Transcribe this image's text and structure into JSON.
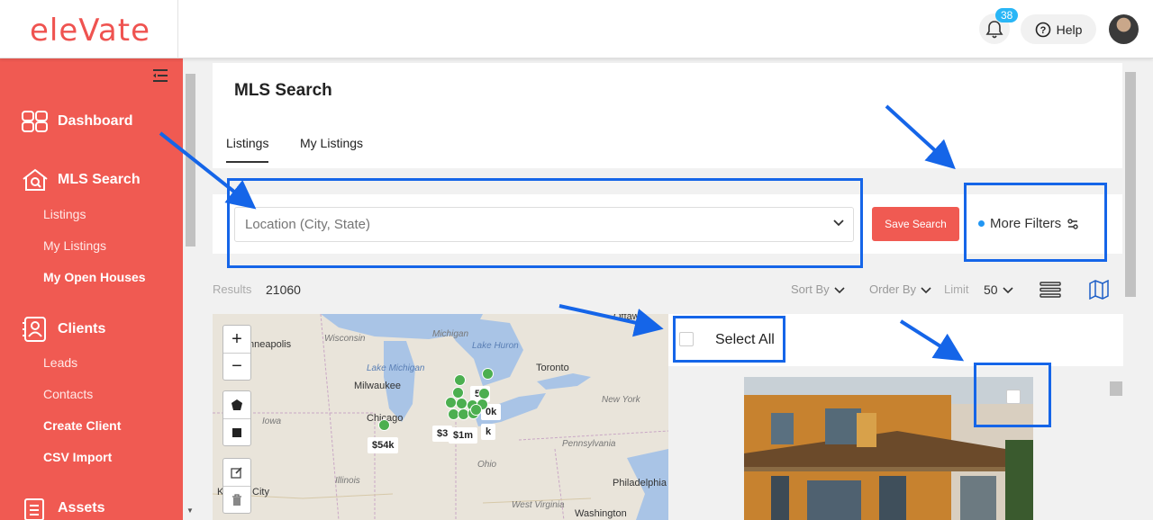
{
  "brand": {
    "logo_text": "eleVate",
    "accent": "#f05a52"
  },
  "header": {
    "notifications_count": "38",
    "help_label": "Help"
  },
  "sidebar": {
    "dashboard": "Dashboard",
    "mls_search": "MLS Search",
    "mls_items": [
      "Listings",
      "My Listings",
      "My Open Houses"
    ],
    "clients": "Clients",
    "client_items": [
      "Leads",
      "Contacts",
      "Create Client",
      "CSV Import"
    ],
    "assets": "Assets"
  },
  "page": {
    "title": "MLS Search",
    "tabs": [
      "Listings",
      "My Listings"
    ],
    "active_tab": "Listings"
  },
  "search": {
    "location_placeholder": "Location (City, State)",
    "save_label": "Save Search",
    "more_filters_label": "More Filters"
  },
  "results": {
    "label": "Results",
    "count": "21060",
    "sort_by": "Sort By",
    "order_by": "Order By",
    "limit_label": "Limit",
    "limit_value": "50"
  },
  "map": {
    "labels": {
      "minneapolis": "nneapolis",
      "wisconsin": "Wisconsin",
      "michigan": "Michigan",
      "lake_huron": "Lake Huron",
      "ottawa": "Ottawa",
      "toronto": "Toronto",
      "lake_michigan": "Lake Michigan",
      "milwaukee": "Milwaukee",
      "new_york": "New York",
      "iowa": "Iowa",
      "chicago": "Chicago",
      "pennsylvania": "Pennsylvania",
      "ohio": "Ohio",
      "illinois": "Illinois",
      "city": "City",
      "philadelphia": "Philadelphia",
      "west_virginia": "West Virginia",
      "washington": "Washington",
      "k": "K"
    },
    "price_tags": [
      "$54k",
      "$1m",
      "$3",
      "5k",
      "0k",
      "k"
    ]
  },
  "listings": {
    "select_all_label": "Select All"
  }
}
